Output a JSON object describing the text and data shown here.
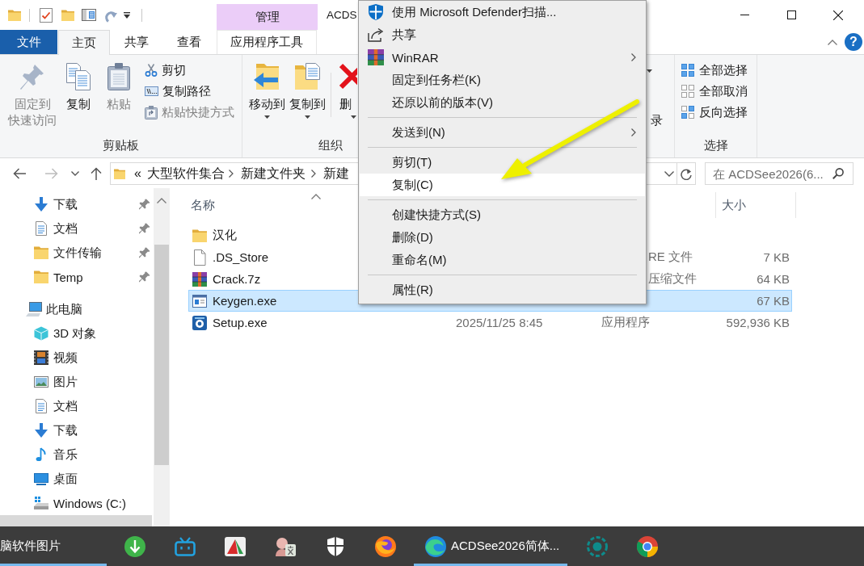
{
  "title_bar": {
    "tool_group": "管理",
    "title": "ACDS"
  },
  "ribbon_tabs": [
    {
      "label": "文件",
      "kind": "file",
      "selected": false
    },
    {
      "label": "主页",
      "kind": "tab",
      "selected": true
    },
    {
      "label": "共享",
      "kind": "tab",
      "selected": false
    },
    {
      "label": "查看",
      "kind": "tab",
      "selected": false
    },
    {
      "label": "应用程序工具",
      "kind": "context",
      "selected": false
    }
  ],
  "help_button": "?",
  "ribbon": {
    "clipboard": {
      "label": "剪贴板",
      "commands": [
        {
          "lines": [
            "固定到",
            "快速访问"
          ],
          "kind": "large",
          "disabled": true
        },
        {
          "label": "复制",
          "kind": "large",
          "disabled": false
        },
        {
          "label": "粘贴",
          "kind": "large",
          "disabled": true
        },
        {
          "label": "剪切",
          "kind": "small",
          "disabled": false
        },
        {
          "label": "复制路径",
          "kind": "small",
          "disabled": false
        },
        {
          "label": "粘贴快捷方式",
          "kind": "small",
          "disabled": true
        }
      ]
    },
    "organize": {
      "label": "组织",
      "commands": [
        {
          "label": "移动到",
          "kind": "large",
          "disabled": false
        },
        {
          "label": "复制到",
          "kind": "large",
          "disabled": false
        },
        {
          "label": "删",
          "kind": "large",
          "disabled": false
        }
      ]
    },
    "history": {
      "label": "录"
    },
    "select": {
      "label": "选择",
      "commands": [
        {
          "label": "全部选择",
          "kind": "small",
          "disabled": false
        },
        {
          "label": "全部取消",
          "kind": "small",
          "disabled": false
        },
        {
          "label": "反向选择",
          "kind": "small",
          "disabled": false
        }
      ]
    }
  },
  "nav_buttons": [
    {
      "kind": "back",
      "disabled": false
    },
    {
      "kind": "forward",
      "disabled": true
    },
    {
      "kind": "recent",
      "disabled": false
    },
    {
      "kind": "up",
      "disabled": false
    }
  ],
  "address_bar": {
    "overflow": "«",
    "path": [
      "大型软件集合",
      "新建文件夹",
      "新建"
    ]
  },
  "search": {
    "placeholder": "在 ACDSee2026(6..."
  },
  "navigation_pane": {
    "quick_access": [
      {
        "label": "下载",
        "kind": "downloads",
        "pinned": true
      },
      {
        "label": "文档",
        "kind": "documents",
        "pinned": true
      },
      {
        "label": "文件传输",
        "kind": "folder",
        "pinned": true
      },
      {
        "label": "Temp",
        "kind": "folder",
        "pinned": true
      }
    ],
    "this_pc": {
      "label": "此电脑",
      "children": [
        {
          "label": "3D 对象",
          "kind": "objects",
          "selected": false
        },
        {
          "label": "视频",
          "kind": "videos",
          "selected": false
        },
        {
          "label": "图片",
          "kind": "pictures",
          "selected": false
        },
        {
          "label": "文档",
          "kind": "documents",
          "selected": false
        },
        {
          "label": "下载",
          "kind": "downloads",
          "selected": false
        },
        {
          "label": "音乐",
          "kind": "music",
          "selected": false
        },
        {
          "label": "桌面",
          "kind": "desktop",
          "selected": false
        },
        {
          "label": "Windows (C:)",
          "kind": "drive",
          "selected": false
        },
        {
          "selected": true
        }
      ]
    }
  },
  "file_list": {
    "columns": [
      {
        "label": "名称",
        "sorted": true
      },
      {
        "label": "大小",
        "sorted": false
      }
    ],
    "rows": [
      {
        "name": "汉化",
        "kind": "folder",
        "selected": false
      },
      {
        "name": ".DS_Store",
        "kind": "blank",
        "type": "RE 文件",
        "size": "7 KB",
        "selected": false
      },
      {
        "name": "Crack.7z",
        "kind": "archive",
        "type": "压缩文件",
        "size": "64 KB",
        "selected": false
      },
      {
        "name": "Keygen.exe",
        "kind": "window",
        "size": "67 KB",
        "selected": true
      },
      {
        "name": "Setup.exe",
        "kind": "installer",
        "modified": "2025/11/25 8:45",
        "type": "应用程序",
        "size": "592,936 KB",
        "selected": false
      }
    ]
  },
  "context_menu": {
    "items": [
      {
        "kind": "shield",
        "label": "使用 Microsoft Defender扫描...",
        "submenu": false,
        "selected": false
      },
      {
        "kind": "share",
        "label": "共享",
        "submenu": false,
        "selected": false
      },
      {
        "kind": "archive",
        "label": "WinRAR",
        "submenu": true,
        "selected": false
      },
      {
        "kind": "text",
        "label": "固定到任务栏(K)",
        "submenu": false,
        "selected": false
      },
      {
        "kind": "text",
        "label": "还原以前的版本(V)",
        "submenu": false,
        "selected": false
      },
      {
        "kind": "separator"
      },
      {
        "kind": "text",
        "label": "发送到(N)",
        "submenu": true,
        "selected": false
      },
      {
        "kind": "separator"
      },
      {
        "kind": "text",
        "label": "剪切(T)",
        "submenu": false,
        "selected": false
      },
      {
        "kind": "text",
        "label": "复制(C)",
        "submenu": false,
        "selected": true
      },
      {
        "kind": "separator"
      },
      {
        "kind": "text",
        "label": "创建快捷方式(S)",
        "submenu": false,
        "selected": false
      },
      {
        "kind": "text",
        "label": "删除(D)",
        "submenu": false,
        "selected": false
      },
      {
        "kind": "text",
        "label": "重命名(M)",
        "submenu": false,
        "selected": false
      },
      {
        "kind": "separator"
      },
      {
        "kind": "text",
        "label": "属性(R)",
        "submenu": false,
        "selected": false
      }
    ]
  },
  "taskbar": {
    "items": [
      {
        "kind": "label",
        "label": "脑软件图片",
        "running": true
      },
      {
        "kind": "arrowcircle",
        "running": false
      },
      {
        "kind": "tv",
        "running": false
      },
      {
        "kind": "wedges",
        "running": false
      },
      {
        "kind": "figure",
        "running": false
      },
      {
        "kind": "shield",
        "running": false
      },
      {
        "kind": "swirl",
        "running": false
      },
      {
        "kind": "wave",
        "label": "ACDSee2026简体...",
        "running": true
      },
      {
        "kind": "ring",
        "running": false
      },
      {
        "kind": "orb",
        "running": false
      }
    ]
  }
}
